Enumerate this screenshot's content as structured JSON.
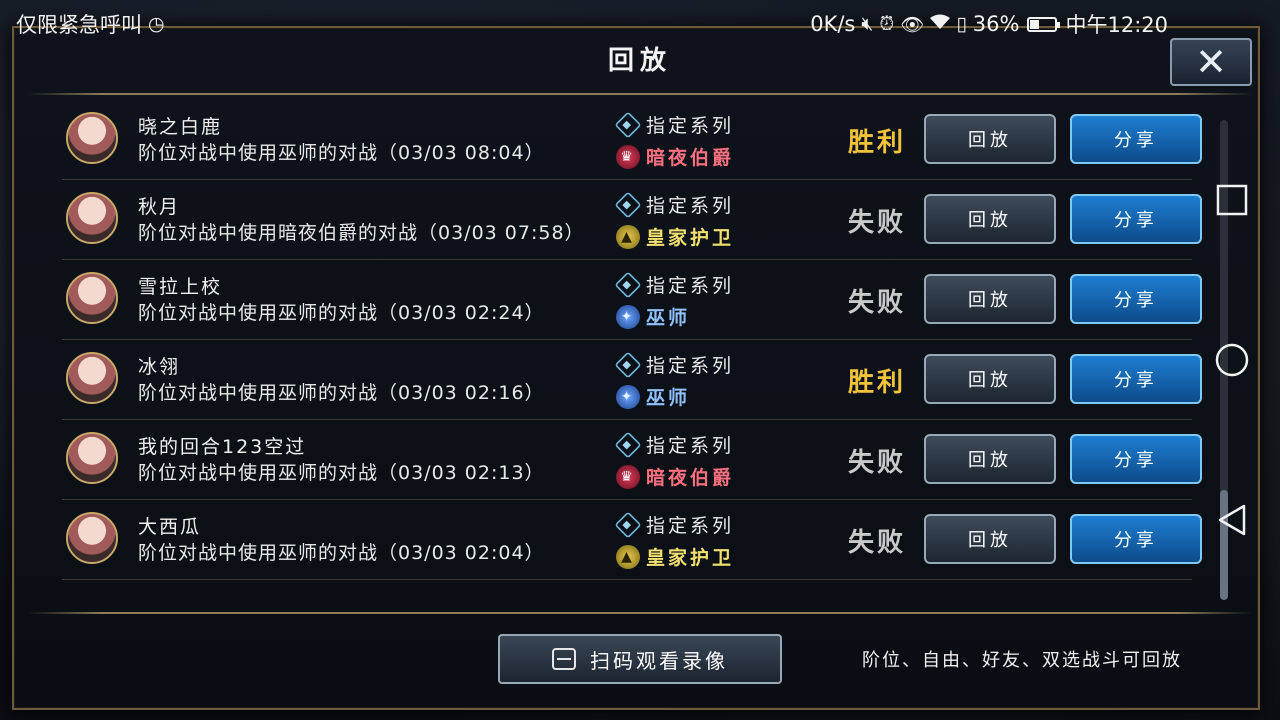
{
  "status_bar": {
    "left_text": "仅限紧急呼叫",
    "speed": "0K/s",
    "battery": "36%",
    "time": "中午12:20"
  },
  "dialog": {
    "title": "回放",
    "close_label": "✕"
  },
  "records": [
    {
      "name": "晓之白鹿",
      "desc": "阶位对战中使用巫师的对战（03/03 08:04）",
      "tag1": "指定系列",
      "tag2": "暗夜伯爵",
      "tag2_type": "red",
      "result": "胜利",
      "result_type": "win"
    },
    {
      "name": "秋月",
      "desc": "阶位对战中使用暗夜伯爵的对战（03/03 07:58）",
      "tag1": "指定系列",
      "tag2": "皇家护卫",
      "tag2_type": "gold",
      "result": "失败",
      "result_type": "lose"
    },
    {
      "name": "雪拉上校",
      "desc": "阶位对战中使用巫师的对战（03/03 02:24）",
      "tag1": "指定系列",
      "tag2": "巫师",
      "tag2_type": "blue",
      "result": "失败",
      "result_type": "lose"
    },
    {
      "name": "冰翎",
      "desc": "阶位对战中使用巫师的对战（03/03 02:16）",
      "tag1": "指定系列",
      "tag2": "巫师",
      "tag2_type": "blue",
      "result": "胜利",
      "result_type": "win"
    },
    {
      "name": "我的回合123空过",
      "desc": "阶位对战中使用巫师的对战（03/03 02:13）",
      "tag1": "指定系列",
      "tag2": "暗夜伯爵",
      "tag2_type": "red",
      "result": "失败",
      "result_type": "lose"
    },
    {
      "name": "大西瓜",
      "desc": "阶位对战中使用巫师的对战（03/03 02:04）",
      "tag1": "指定系列",
      "tag2": "皇家护卫",
      "tag2_type": "gold",
      "result": "失败",
      "result_type": "lose"
    }
  ],
  "buttons": {
    "replay": "回放",
    "share": "分享"
  },
  "bottom": {
    "scan_label": "扫码观看录像",
    "hint": "阶位、自由、好友、双选战斗可回放"
  }
}
